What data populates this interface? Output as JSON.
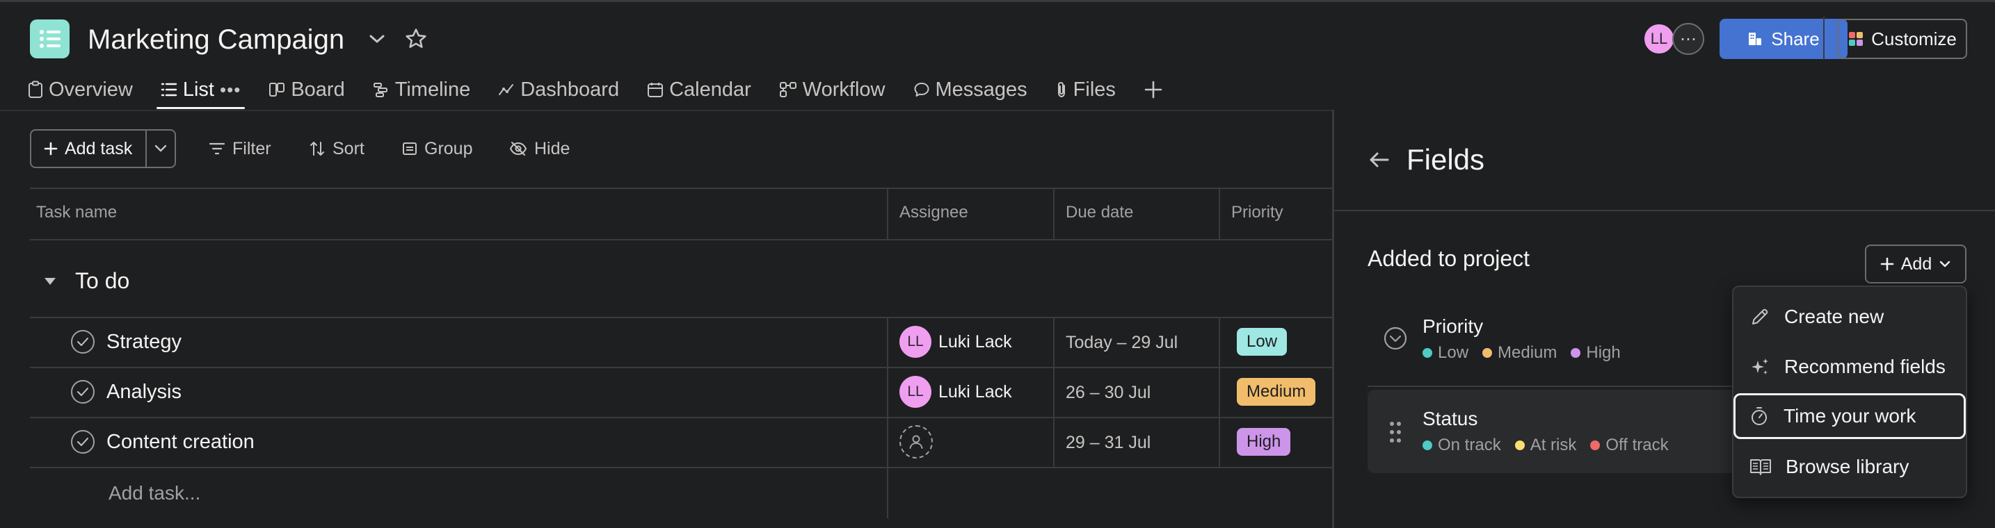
{
  "project": {
    "title": "Marketing Campaign"
  },
  "tabs": [
    {
      "label": "Overview"
    },
    {
      "label": "List",
      "active": true
    },
    {
      "label": "Board"
    },
    {
      "label": "Timeline"
    },
    {
      "label": "Dashboard"
    },
    {
      "label": "Calendar"
    },
    {
      "label": "Workflow"
    },
    {
      "label": "Messages"
    },
    {
      "label": "Files"
    }
  ],
  "header": {
    "avatar_initials": "LL",
    "share_label": "Share",
    "customize_label": "Customize"
  },
  "toolbar": {
    "add_task_label": "Add task",
    "filter_label": "Filter",
    "sort_label": "Sort",
    "group_label": "Group",
    "hide_label": "Hide"
  },
  "table": {
    "columns": {
      "task_name": "Task name",
      "assignee": "Assignee",
      "due_date": "Due date",
      "priority": "Priority"
    },
    "section_title": "To do",
    "rows": [
      {
        "name": "Strategy",
        "assignee_initials": "LL",
        "assignee_name": "Luki Lack",
        "due": "Today – 29 Jul",
        "priority": "Low",
        "priority_color": "#9ee7e3"
      },
      {
        "name": "Analysis",
        "assignee_initials": "LL",
        "assignee_name": "Luki Lack",
        "due": "26 – 30 Jul",
        "priority": "Medium",
        "priority_color": "#f1bd6c"
      },
      {
        "name": "Content creation",
        "assignee_initials": "",
        "assignee_name": "",
        "due": "29 – 31 Jul",
        "priority": "High",
        "priority_color": "#cd95ea"
      }
    ],
    "add_task_placeholder": "Add task..."
  },
  "panel": {
    "title": "Fields",
    "section_title": "Added to project",
    "add_label": "Add",
    "fields": [
      {
        "name": "Priority",
        "options": [
          {
            "label": "Low",
            "color": "#4ecbc4"
          },
          {
            "label": "Medium",
            "color": "#f1bd6c"
          },
          {
            "label": "High",
            "color": "#cd95ea"
          }
        ]
      },
      {
        "name": "Status",
        "options": [
          {
            "label": "On track",
            "color": "#4ecbc4"
          },
          {
            "label": "At risk",
            "color": "#f8df72"
          },
          {
            "label": "Off track",
            "color": "#f06a6a"
          }
        ]
      }
    ]
  },
  "menu": {
    "items": [
      {
        "label": "Create new",
        "icon": "pencil-icon"
      },
      {
        "label": "Recommend fields",
        "icon": "sparkle-icon"
      },
      {
        "label": "Time your work",
        "icon": "stopwatch-icon",
        "focused": true
      },
      {
        "label": "Browse library",
        "icon": "book-icon"
      }
    ]
  }
}
